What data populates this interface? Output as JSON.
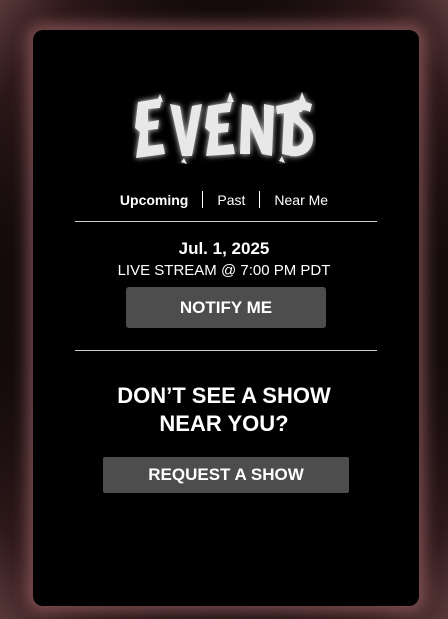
{
  "logo": {
    "text": "EVENTS"
  },
  "tabs": [
    {
      "label": "Upcoming",
      "active": true
    },
    {
      "label": "Past",
      "active": false
    },
    {
      "label": "Near Me",
      "active": false
    }
  ],
  "event": {
    "date": "Jul. 1, 2025",
    "description": "LIVE STREAM @ 7:00 PM PDT",
    "notify_label": "NOTIFY ME"
  },
  "cta": {
    "heading_line1": "DON’T SEE A SHOW",
    "heading_line2": "NEAR YOU?",
    "button_label": "REQUEST A SHOW"
  },
  "colors": {
    "background": "#000000",
    "button": "#4d4d4d",
    "glow": "#aa6e70",
    "text": "#ffffff"
  }
}
